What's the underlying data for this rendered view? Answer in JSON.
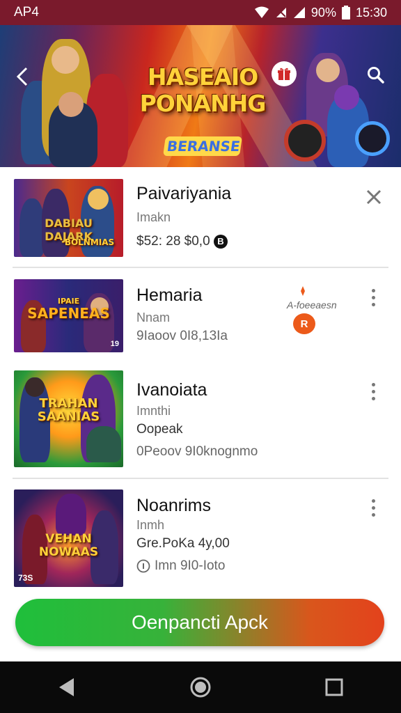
{
  "status_bar": {
    "carrier": "AP4",
    "battery": "90%",
    "time": "15:30"
  },
  "banner": {
    "title_line1": "HASEAIO",
    "title_line2": "PONANHG",
    "subtitle": "BERANSE"
  },
  "colors": {
    "status_bar": "#7a1a2c",
    "cta_start": "#1fbf3b",
    "cta_end": "#e3421c",
    "accent_orange": "#ec5a1a"
  },
  "list": [
    {
      "thumb_text": "DABIAU\nDAJARK",
      "thumb_sub": "BOLNMIAS",
      "title": "Paivariyania",
      "subtitle": "Imakn",
      "meta": "$52: 28  $0,0",
      "badge": "B"
    },
    {
      "thumb_text": "SAPENEAS",
      "thumb_sub": "IPAIE",
      "thumb_corner": "19",
      "title": "Hemaria",
      "subtitle": "Nnam",
      "meta": "9Iaoov  0I8,13Ia",
      "side_label": "A-foeeaesn",
      "side_badge": "R"
    },
    {
      "thumb_text": "TRAHAN\nSAANIAS",
      "title": "Ivanoiata",
      "subtitle": "Imnthi",
      "meta1": "Oopeak",
      "meta2": "0Peoov  9I0knognmo"
    },
    {
      "thumb_text": "VEHAN\nNOWAAS",
      "thumb_corner": "73S",
      "title": "Noanrims",
      "subtitle": "Inmh",
      "meta1": "Gre.PoKa 4y,00",
      "meta2": "Imn  9I0-Ioto"
    }
  ],
  "cta": {
    "label": "Oenpancti Apck"
  }
}
